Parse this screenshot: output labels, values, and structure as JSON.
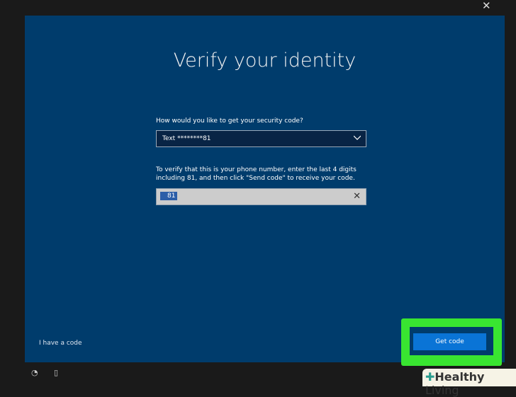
{
  "window": {
    "close_icon": "✕"
  },
  "title": "Verify your identity",
  "method": {
    "label": "How would you like to get your security code?",
    "value": "Text ********81"
  },
  "verify": {
    "label": "To verify that this is your phone number, enter the last 4 digits including 81, and then click \"Send code\" to receive your code.",
    "value": "81"
  },
  "links": {
    "have_code": "I have a code"
  },
  "buttons": {
    "get_code": "Get code"
  },
  "watermark": {
    "brand": "Healthy",
    "brand2": "Living"
  }
}
